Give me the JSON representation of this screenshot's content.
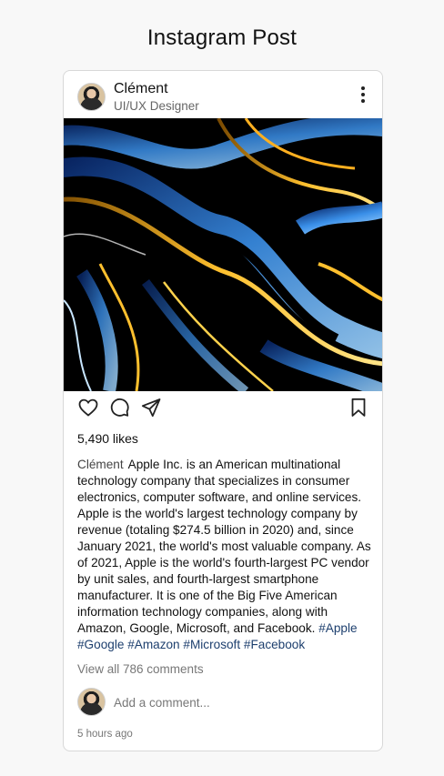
{
  "page": {
    "title": "Instagram Post"
  },
  "post": {
    "user": {
      "name": "Clément",
      "role": "UI/UX Designer"
    },
    "likes": "5,490 likes",
    "caption": {
      "author": "Clément",
      "text": "Apple Inc. is an American multinational technology company that specializes in consumer electronics, computer software, and online services. Apple is the world's largest technology company by revenue (totaling $274.5 billion in 2020) and, since January 2021, the world's most valuable company. As of 2021, Apple is the world's fourth-largest PC vendor by unit sales, and fourth-largest smartphone manufacturer. It is one of the Big Five American information technology companies, along with Amazon, Google, Microsoft, and Facebook.",
      "hashtags": [
        "#Apple",
        "#Google",
        "#Amazon",
        "#Microsoft",
        "#Facebook"
      ]
    },
    "comments_link": "View all 786 comments",
    "comment_placeholder": "Add a comment...",
    "timestamp": "5 hours ago"
  },
  "icons": {
    "more": "more-vertical-icon",
    "like": "heart-icon",
    "comment": "comment-bubble-icon",
    "share": "paper-plane-icon",
    "save": "bookmark-icon"
  },
  "colors": {
    "hashtag": "#1d3f6e",
    "muted": "#777777",
    "background": "#f8f8f8"
  }
}
